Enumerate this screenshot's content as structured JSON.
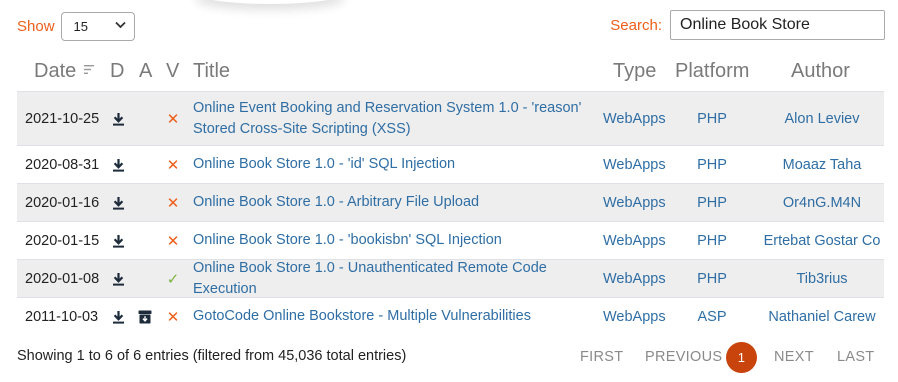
{
  "length_menu": {
    "label": "Show",
    "value": "15"
  },
  "search": {
    "label": "Search:",
    "value": "Online Book Store"
  },
  "columns": {
    "date": "Date",
    "d": "D",
    "a": "A",
    "v": "V",
    "title": "Title",
    "type": "Type",
    "platform": "Platform",
    "author": "Author"
  },
  "rows": [
    {
      "date": "2021-10-25",
      "download": true,
      "app": false,
      "verified": false,
      "title_line1": "Online Event Booking and Reservation System 1.0 - 'reason'",
      "title_line2": "Stored Cross-Site Scripting (XSS)",
      "type": "WebApps",
      "platform": "PHP",
      "author": "Alon Leviev"
    },
    {
      "date": "2020-08-31",
      "download": true,
      "app": false,
      "verified": false,
      "title_line1": "Online Book Store 1.0 - 'id' SQL Injection",
      "title_line2": "",
      "type": "WebApps",
      "platform": "PHP",
      "author": "Moaaz Taha"
    },
    {
      "date": "2020-01-16",
      "download": true,
      "app": false,
      "verified": false,
      "title_line1": "Online Book Store 1.0 - Arbitrary File Upload",
      "title_line2": "",
      "type": "WebApps",
      "platform": "PHP",
      "author": "Or4nG.M4N"
    },
    {
      "date": "2020-01-15",
      "download": true,
      "app": false,
      "verified": false,
      "title_line1": "Online Book Store 1.0 - 'bookisbn' SQL Injection",
      "title_line2": "",
      "type": "WebApps",
      "platform": "PHP",
      "author": "Ertebat Gostar Co"
    },
    {
      "date": "2020-01-08",
      "download": true,
      "app": false,
      "verified": true,
      "title_line1": "Online Book Store 1.0 - Unauthenticated Remote Code Execution",
      "title_line2": "",
      "type": "WebApps",
      "platform": "PHP",
      "author": "Tib3rius"
    },
    {
      "date": "2011-10-03",
      "download": true,
      "app": true,
      "verified": false,
      "title_line1": "GotoCode Online Bookstore - Multiple Vulnerabilities",
      "title_line2": "",
      "type": "WebApps",
      "platform": "ASP",
      "author": "Nathaniel Carew"
    }
  ],
  "verified_glyphs": {
    "yes": "✓",
    "no": "✕"
  },
  "info": "Showing 1 to 6 of 6 entries (filtered from 45,036 total entries)",
  "pagination": {
    "first": "FIRST",
    "previous": "PREVIOUS",
    "current": "1",
    "next": "NEXT",
    "last": "LAST"
  },
  "colors": {
    "accent": "#ec5f1b",
    "link": "#2f6ea4",
    "stripe": "#eeeeee",
    "current_page": "#c9430c",
    "verified": "#7cb342"
  },
  "icons": {
    "download": "download-icon",
    "app": "archive-icon",
    "sort": "sort-icon"
  }
}
